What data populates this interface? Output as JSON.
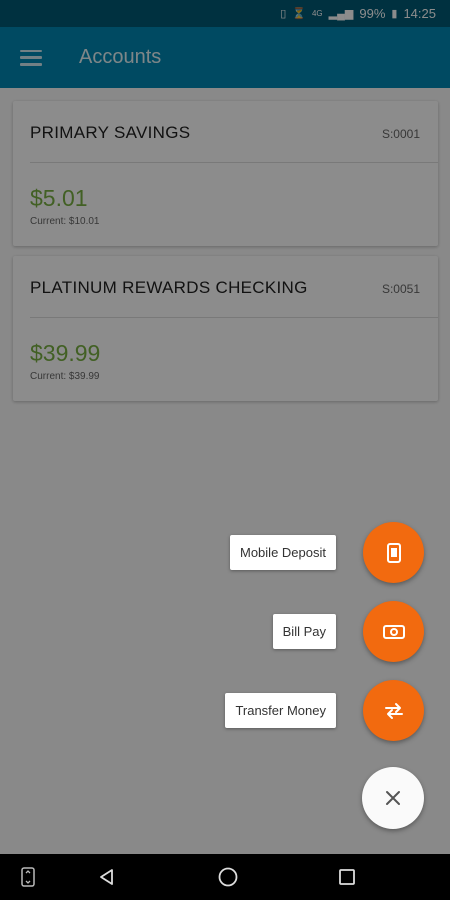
{
  "status_bar": {
    "battery": "99%",
    "time": "14:25",
    "network": "4G"
  },
  "app_bar": {
    "title": "Accounts"
  },
  "accounts": [
    {
      "name": "PRIMARY SAVINGS",
      "number": "S:0001",
      "amount": "$5.01",
      "current": "Current: $10.01"
    },
    {
      "name": "PLATINUM REWARDS CHECKING",
      "number": "S:0051",
      "amount": "$39.99",
      "current": "Current: $39.99"
    }
  ],
  "fab_menu": {
    "mobile_deposit": "Mobile Deposit",
    "bill_pay": "Bill Pay",
    "transfer_money": "Transfer Money"
  },
  "colors": {
    "primary": "#0088b3",
    "status": "#005a75",
    "accent": "#f26a0f",
    "amount": "#78b043"
  },
  "icons": {
    "menu": "hamburger-icon",
    "mobile_deposit": "check-deposit-icon",
    "bill_pay": "bill-pay-icon",
    "transfer": "transfer-arrows-icon",
    "close": "close-icon"
  }
}
